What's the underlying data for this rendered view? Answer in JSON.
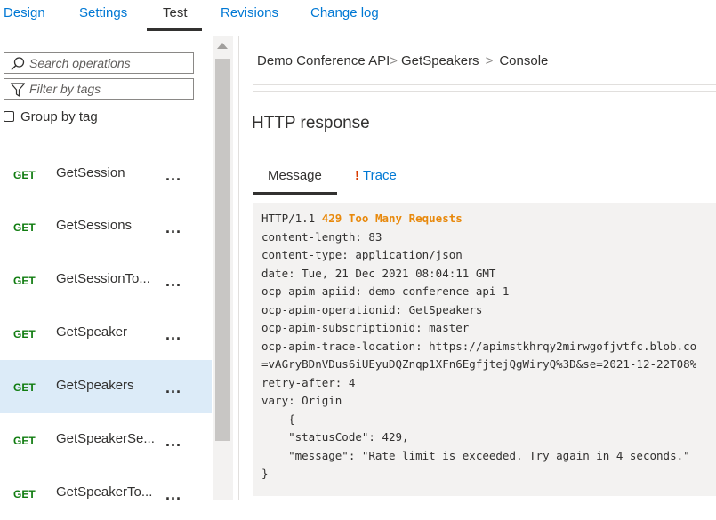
{
  "tabs": [
    {
      "label": "Design"
    },
    {
      "label": "Settings"
    },
    {
      "label": "Test"
    },
    {
      "label": "Revisions"
    },
    {
      "label": "Change log"
    }
  ],
  "active_tab": "Test",
  "left": {
    "search_placeholder": "Search operations",
    "filter_placeholder": "Filter by tags",
    "group_by_tag_label": "Group by tag",
    "group_by_tag_checked": false,
    "operations": [
      {
        "method": "GET",
        "name": "GetSession",
        "selected": false
      },
      {
        "method": "GET",
        "name": "GetSessions",
        "selected": false
      },
      {
        "method": "GET",
        "name": "GetSessionTo...",
        "selected": false
      },
      {
        "method": "GET",
        "name": "GetSpeaker",
        "selected": false
      },
      {
        "method": "GET",
        "name": "GetSpeakers",
        "selected": true
      },
      {
        "method": "GET",
        "name": "GetSpeakerSe...",
        "selected": false
      },
      {
        "method": "GET",
        "name": "GetSpeakerTo...",
        "selected": false
      }
    ],
    "more_label": "..."
  },
  "breadcrumb": {
    "api": "Demo Conference API",
    "sep1": ">",
    "operation": "GetSpeakers",
    "sep2": ">",
    "page": "Console"
  },
  "response": {
    "title": "HTTP response",
    "tab_message": "Message",
    "tab_trace_bang": "!",
    "tab_trace": "Trace",
    "status_prefix": "HTTP/1.1 ",
    "status_text": "429 Too Many Requests",
    "lines": [
      "content-length: 83",
      "content-type: application/json",
      "date: Tue, 21 Dec 2021 08:04:11 GMT",
      "ocp-apim-apiid: demo-conference-api-1",
      "ocp-apim-operationid: GetSpeakers",
      "ocp-apim-subscriptionid: master",
      "ocp-apim-trace-location: https://apimstkhrqy2mirwgofjvtfc.blob.co",
      "=vAGryBDnVDus6iUEyuDQZnqp1XFn6EgfjtejQgWiryQ%3D&se=2021-12-22T08%",
      "retry-after: 4",
      "vary: Origin",
      "    {",
      "    \"statusCode\": 429,",
      "    \"message\": \"Rate limit is exceeded. Try again in 4 seconds.\"",
      "}"
    ]
  },
  "colors": {
    "accent": "#0078d4",
    "get_method": "#107c10",
    "status_429": "#e8890c",
    "selected_row": "#dcebf8"
  }
}
